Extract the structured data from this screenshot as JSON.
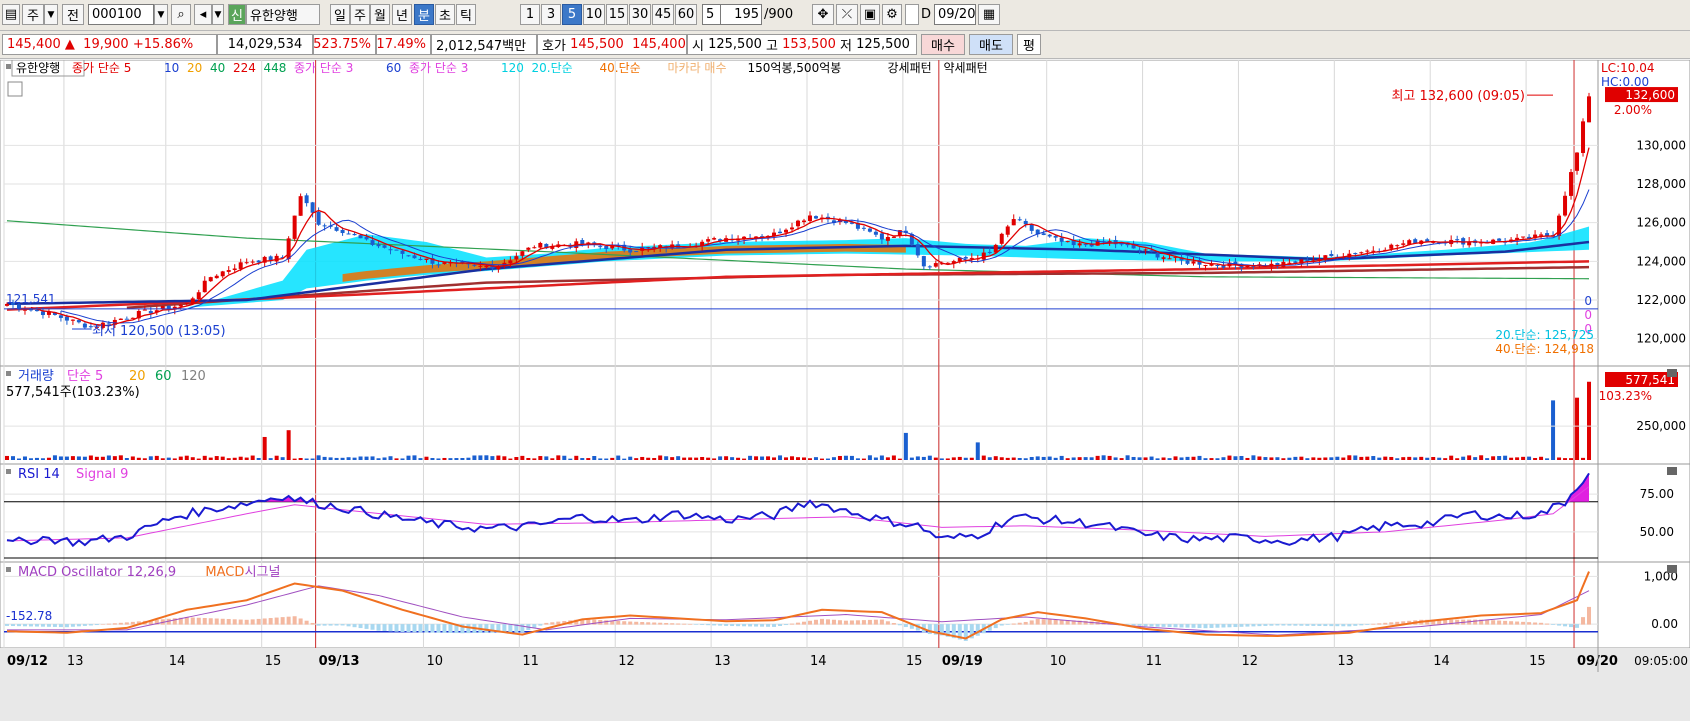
{
  "toolbar": {
    "type_label": "주",
    "prev_label": "전",
    "code": "000100",
    "new_badge": "신",
    "stock_name": "유한양행",
    "periods": [
      "일",
      "주",
      "월",
      "년",
      "분",
      "초",
      "틱"
    ],
    "active_period": "분",
    "intervals": [
      "1",
      "3",
      "5",
      "10",
      "15",
      "30",
      "45",
      "60"
    ],
    "active_interval": "5",
    "interval_value": "5",
    "count_value": "195",
    "count_total": "/900",
    "d_label": "D",
    "date_value": "09/20"
  },
  "quote": {
    "price": "145,400",
    "arrow": "▲",
    "change": "19,900",
    "change_pct": "+15.86%",
    "volume": "14,029,534",
    "vol_ratio": "523.75%",
    "turnover": "17.49%",
    "amount": "2,012,547백만",
    "hoga_label": "호가",
    "ask": "145,500",
    "bid": "145,400",
    "open_label": "시",
    "open": "125,500",
    "high_label": "고",
    "high": "153,500",
    "low_label": "저",
    "low": "125,500",
    "buy_label": "매수",
    "sell_label": "매도",
    "flat_label": "평"
  },
  "colors": {
    "up": "#e00000",
    "down": "#1a5fd0",
    "ma5": "#e00000",
    "ma10": "#1a3fd0",
    "ma20": "#f0a000",
    "ma40": "#00a050",
    "ma224": "#e00000",
    "ma448": "#00a050",
    "cyan": "#00e0ff",
    "orange": "#f07000",
    "rsi": "#1a1ad0",
    "signal": "#e040e0",
    "macd": "#f07020",
    "macd_signal": "#a050c0"
  },
  "chart_data": [
    {
      "type": "candlestick",
      "title": "",
      "legend": [
        {
          "text": "유한양행",
          "color": "#000000"
        },
        {
          "text": "종가 단순 5",
          "color": "#e00000"
        },
        {
          "text": "10",
          "color": "#1a3fd0"
        },
        {
          "text": "20",
          "color": "#f0a000"
        },
        {
          "text": "40",
          "color": "#00a050"
        },
        {
          "text": "224",
          "color": "#e00000"
        },
        {
          "text": "448",
          "color": "#00a050"
        },
        {
          "text": "종가 단순 3",
          "color": "#e040e0"
        },
        {
          "text": "60",
          "color": "#1a3fd0"
        },
        {
          "text": "종가 단순 3",
          "color": "#e040e0"
        },
        {
          "text": "120",
          "color": "#00d0e0"
        },
        {
          "text": "20.단순",
          "color": "#00d0e0"
        },
        {
          "text": "40.단순",
          "color": "#f07000"
        },
        {
          "text": "마카라 매수",
          "color": "#f0b070"
        },
        {
          "text": "150억봉,500억봉",
          "color": "#000000"
        },
        {
          "text": "강세패턴",
          "color": "#000000"
        },
        {
          "text": "약세패턴",
          "color": "#000000"
        }
      ],
      "ylim": [
        119000,
        134000
      ],
      "y_ticks": [
        "120,000",
        "122,000",
        "124,000",
        "126,000",
        "128,000",
        "130,000"
      ],
      "lc_label": "LC:10.04",
      "hc_label": "HC:0.00",
      "last_price_label": "132,600",
      "pct_label": "2.00%",
      "high_annotation": "최고 132,600 (09:05)",
      "low_annotation": "최저 120,500 (13:05)",
      "left_price_label": "121,541",
      "zero_labels": [
        "0",
        "0",
        "0"
      ],
      "ma20_value": "20.단순: 125,725",
      "ma40_value": "40.단순: 124,918",
      "series_points": {
        "close_keypoints": [
          [
            0,
            121.8
          ],
          [
            8,
            121.2
          ],
          [
            14,
            120.6
          ],
          [
            22,
            121.3
          ],
          [
            30,
            121.8
          ],
          [
            34,
            123.2
          ],
          [
            40,
            124.0
          ],
          [
            46,
            124.2
          ],
          [
            49,
            127.4
          ],
          [
            52,
            126.0
          ],
          [
            56,
            125.6
          ],
          [
            60,
            125.0
          ],
          [
            66,
            124.4
          ],
          [
            72,
            123.9
          ],
          [
            78,
            123.7
          ],
          [
            82,
            123.8
          ],
          [
            88,
            124.8
          ],
          [
            96,
            124.9
          ],
          [
            104,
            124.6
          ],
          [
            112,
            124.8
          ],
          [
            120,
            125.2
          ],
          [
            128,
            125.4
          ],
          [
            134,
            126.4
          ],
          [
            140,
            126.0
          ],
          [
            146,
            125.2
          ],
          [
            150,
            125.6
          ],
          [
            153,
            123.8
          ],
          [
            158,
            124.0
          ],
          [
            164,
            124.4
          ],
          [
            168,
            126.2
          ],
          [
            172,
            125.4
          ],
          [
            178,
            124.8
          ],
          [
            184,
            125.0
          ],
          [
            190,
            124.5
          ],
          [
            196,
            124.0
          ],
          [
            204,
            123.8
          ],
          [
            212,
            123.8
          ],
          [
            220,
            124.2
          ],
          [
            228,
            124.6
          ],
          [
            236,
            125.1
          ],
          [
            244,
            125.0
          ],
          [
            252,
            125.1
          ],
          [
            258,
            125.4
          ],
          [
            262,
            129.6
          ],
          [
            264,
            132.6
          ]
        ],
        "ma_blue": [
          [
            0,
            121.8
          ],
          [
            40,
            122.0
          ],
          [
            80,
            123.6
          ],
          [
            120,
            124.6
          ],
          [
            150,
            124.8
          ],
          [
            180,
            124.6
          ],
          [
            220,
            124.1
          ],
          [
            250,
            124.5
          ],
          [
            264,
            125.0
          ]
        ],
        "ma_red_long": [
          [
            0,
            121.5
          ],
          [
            60,
            122.3
          ],
          [
            120,
            123.2
          ],
          [
            160,
            123.4
          ],
          [
            200,
            123.6
          ],
          [
            264,
            124.0
          ]
        ],
        "ma_brown": [
          [
            20,
            121.6
          ],
          [
            80,
            122.9
          ],
          [
            140,
            123.3
          ],
          [
            200,
            123.4
          ],
          [
            264,
            123.7
          ]
        ],
        "ma_green": [
          [
            0,
            126.1
          ],
          [
            40,
            125.2
          ],
          [
            90,
            124.5
          ],
          [
            150,
            123.6
          ],
          [
            200,
            123.2
          ],
          [
            264,
            123.1
          ]
        ],
        "cyan_band_top": [
          [
            30,
            121.6
          ],
          [
            46,
            123.0
          ],
          [
            50,
            124.6
          ],
          [
            60,
            125.4
          ],
          [
            70,
            125.0
          ],
          [
            80,
            124.2
          ],
          [
            90,
            124.4
          ],
          [
            100,
            124.7
          ],
          [
            120,
            125.0
          ],
          [
            140,
            125.1
          ],
          [
            150,
            125.2
          ],
          [
            160,
            124.9
          ],
          [
            170,
            124.8
          ],
          [
            180,
            125.2
          ],
          [
            190,
            125.0
          ],
          [
            200,
            124.4
          ],
          [
            220,
            124.2
          ],
          [
            240,
            124.6
          ],
          [
            255,
            125.0
          ],
          [
            264,
            125.8
          ]
        ],
        "cyan_band_bottom": [
          [
            30,
            121.6
          ],
          [
            46,
            122.0
          ],
          [
            50,
            122.6
          ],
          [
            60,
            123.0
          ],
          [
            70,
            123.3
          ],
          [
            80,
            123.5
          ],
          [
            100,
            124.0
          ],
          [
            120,
            124.3
          ],
          [
            140,
            124.4
          ],
          [
            160,
            124.3
          ],
          [
            180,
            124.1
          ],
          [
            200,
            124.0
          ],
          [
            220,
            124.0
          ],
          [
            240,
            124.3
          ],
          [
            264,
            124.6
          ]
        ]
      }
    },
    {
      "type": "bar",
      "name": "volume",
      "legend": [
        {
          "text": "거래량",
          "color": "#1a3fd0"
        },
        {
          "text": "단순 5",
          "color": "#e040e0"
        },
        {
          "text": "20",
          "color": "#f0a000"
        },
        {
          "text": "60",
          "color": "#00a050"
        },
        {
          "text": "120",
          "color": "#808080"
        }
      ],
      "info": "577,541주(103.23%)",
      "y_ticks": [
        "250,000"
      ],
      "last_label": "577,541",
      "pct_label": "103.23%",
      "spikes": [
        [
          43,
          170000
        ],
        [
          47,
          220000
        ],
        [
          150,
          200000
        ],
        [
          162,
          130000
        ],
        [
          258,
          440000
        ],
        [
          262,
          460000
        ],
        [
          264,
          577541
        ]
      ]
    },
    {
      "type": "line",
      "name": "RSI",
      "legend": [
        {
          "text": "RSI 14",
          "color": "#1a1ad0"
        },
        {
          "text": "Signal 9",
          "color": "#e040e0"
        }
      ],
      "ylim": [
        30,
        95
      ],
      "y_ticks": [
        "50.00",
        "75.00"
      ],
      "reference_line": 70,
      "rsi": [
        [
          0,
          42
        ],
        [
          6,
          46
        ],
        [
          12,
          43
        ],
        [
          20,
          47
        ],
        [
          28,
          60
        ],
        [
          34,
          65
        ],
        [
          40,
          69
        ],
        [
          46,
          74
        ],
        [
          50,
          70
        ],
        [
          56,
          66
        ],
        [
          64,
          60
        ],
        [
          72,
          55
        ],
        [
          80,
          52
        ],
        [
          88,
          54
        ],
        [
          96,
          60
        ],
        [
          104,
          57
        ],
        [
          112,
          62
        ],
        [
          120,
          58
        ],
        [
          128,
          61
        ],
        [
          134,
          70
        ],
        [
          140,
          64
        ],
        [
          146,
          58
        ],
        [
          152,
          54
        ],
        [
          156,
          45
        ],
        [
          162,
          48
        ],
        [
          168,
          60
        ],
        [
          174,
          58
        ],
        [
          182,
          55
        ],
        [
          190,
          48
        ],
        [
          198,
          45
        ],
        [
          206,
          46
        ],
        [
          214,
          44
        ],
        [
          222,
          47
        ],
        [
          230,
          54
        ],
        [
          238,
          56
        ],
        [
          244,
          62
        ],
        [
          250,
          60
        ],
        [
          256,
          62
        ],
        [
          260,
          70
        ],
        [
          264,
          90
        ]
      ],
      "signal": [
        [
          0,
          44
        ],
        [
          20,
          46
        ],
        [
          40,
          62
        ],
        [
          48,
          68
        ],
        [
          60,
          63
        ],
        [
          80,
          55
        ],
        [
          100,
          56
        ],
        [
          120,
          58
        ],
        [
          140,
          60
        ],
        [
          156,
          53
        ],
        [
          170,
          54
        ],
        [
          190,
          51
        ],
        [
          210,
          47
        ],
        [
          230,
          50
        ],
        [
          250,
          58
        ],
        [
          258,
          62
        ],
        [
          264,
          80
        ]
      ]
    },
    {
      "type": "line",
      "name": "MACD",
      "legend": [
        {
          "text": "MACD Oscillator 12,26,9",
          "color": "#a040c0"
        },
        {
          "text": "MACD",
          "color": "#f07020"
        },
        {
          "text": "시그널",
          "color": "#a040c0"
        }
      ],
      "ylim": [
        -500,
        1300
      ],
      "y_ticks": [
        "0.00",
        "1,000"
      ],
      "left_label": "-152.78",
      "macd": [
        [
          0,
          -150
        ],
        [
          10,
          -180
        ],
        [
          20,
          -80
        ],
        [
          30,
          300
        ],
        [
          40,
          500
        ],
        [
          48,
          850
        ],
        [
          56,
          700
        ],
        [
          66,
          300
        ],
        [
          76,
          -50
        ],
        [
          86,
          -220
        ],
        [
          96,
          100
        ],
        [
          104,
          180
        ],
        [
          112,
          120
        ],
        [
          120,
          60
        ],
        [
          128,
          80
        ],
        [
          136,
          300
        ],
        [
          146,
          250
        ],
        [
          154,
          -150
        ],
        [
          160,
          -300
        ],
        [
          166,
          100
        ],
        [
          172,
          250
        ],
        [
          180,
          120
        ],
        [
          190,
          -100
        ],
        [
          200,
          -220
        ],
        [
          212,
          -250
        ],
        [
          224,
          -180
        ],
        [
          236,
          50
        ],
        [
          246,
          180
        ],
        [
          256,
          230
        ],
        [
          262,
          500
        ],
        [
          264,
          1100
        ]
      ],
      "signal_line": [
        [
          0,
          -120
        ],
        [
          20,
          -120
        ],
        [
          40,
          400
        ],
        [
          52,
          800
        ],
        [
          62,
          600
        ],
        [
          76,
          150
        ],
        [
          90,
          -120
        ],
        [
          104,
          120
        ],
        [
          120,
          90
        ],
        [
          140,
          200
        ],
        [
          156,
          50
        ],
        [
          170,
          150
        ],
        [
          190,
          -60
        ],
        [
          212,
          -230
        ],
        [
          236,
          -50
        ],
        [
          256,
          200
        ],
        [
          264,
          700
        ]
      ]
    }
  ],
  "x_axis": {
    "labels": [
      {
        "i": 0,
        "text": "09/12",
        "bold": true
      },
      {
        "i": 10,
        "text": "13"
      },
      {
        "i": 27,
        "text": "14"
      },
      {
        "i": 43,
        "text": "15"
      },
      {
        "i": 52,
        "text": "09/13",
        "bold": true
      },
      {
        "i": 70,
        "text": "10"
      },
      {
        "i": 86,
        "text": "11"
      },
      {
        "i": 102,
        "text": "12"
      },
      {
        "i": 118,
        "text": "13"
      },
      {
        "i": 134,
        "text": "14"
      },
      {
        "i": 150,
        "text": "15"
      },
      {
        "i": 156,
        "text": "09/19",
        "bold": true
      },
      {
        "i": 174,
        "text": "10"
      },
      {
        "i": 190,
        "text": "11"
      },
      {
        "i": 206,
        "text": "12"
      },
      {
        "i": 222,
        "text": "13"
      },
      {
        "i": 238,
        "text": "14"
      },
      {
        "i": 254,
        "text": "15"
      },
      {
        "i": 262,
        "text": "09/20",
        "bold": true
      }
    ],
    "time_label": "09:05:00"
  }
}
